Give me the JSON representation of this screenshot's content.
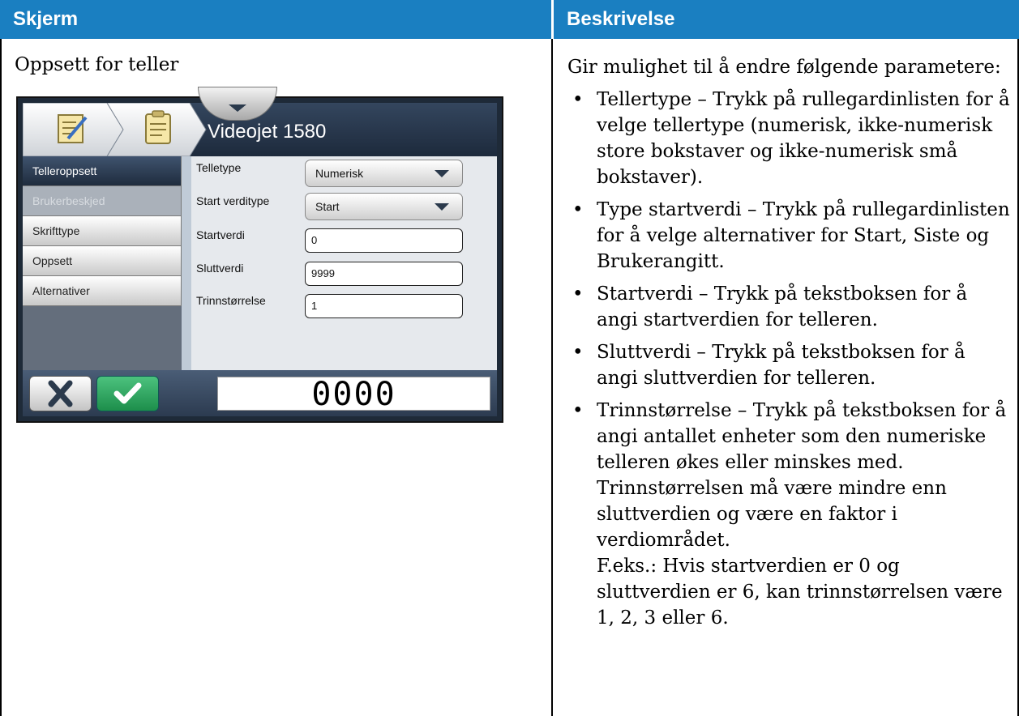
{
  "table": {
    "header_left": "Skjerm",
    "header_right": "Beskrivelse"
  },
  "screen_title": "Oppsett for teller",
  "device": {
    "title": "Videojet 1580",
    "sidebar": [
      {
        "label": "Telleroppsett",
        "state": "active"
      },
      {
        "label": "Brukerbeskjed",
        "state": "disabled"
      },
      {
        "label": "Skrifttype",
        "state": "normal"
      },
      {
        "label": "Oppsett",
        "state": "normal"
      },
      {
        "label": "Alternativer",
        "state": "normal"
      }
    ],
    "fields": {
      "telletype_label": "Telletype",
      "telletype_value": "Numerisk",
      "start_verditype_label": "Start verditype",
      "start_verditype_value": "Start",
      "startverdi_label": "Startverdi",
      "startverdi_value": "0",
      "sluttverdi_label": "Sluttverdi",
      "sluttverdi_value": "9999",
      "trinn_label": "Trinnstørrelse",
      "trinn_value": "1"
    },
    "preview_value": "0000",
    "colors": {
      "ok": "#1d8e4b",
      "header": "#1a7fc1"
    }
  },
  "description": {
    "intro": "Gir mulighet til å endre følgende parametere:",
    "bullets": [
      "Tellertype – Trykk på rullegardinlisten for å velge tellertype (numerisk, ikke-numerisk store bokstaver og ikke-numerisk små bokstaver).",
      "Type startverdi – Trykk på rullegardinlisten for å velge alternativer for Start, Siste og Brukerangitt.",
      "Startverdi – Trykk på tekstboksen for å angi startverdien for telleren.",
      "Sluttverdi – Trykk på tekstboksen for å angi sluttverdien for telleren.",
      "Trinnstørrelse – Trykk på tekstboksen for å angi antallet enheter som den numeriske telleren økes eller minskes med. Trinnstørrelsen må være mindre enn sluttverdien og være en faktor i verdiområdet."
    ],
    "example": "F.eks.: Hvis startverdien er 0 og sluttverdien er 6, kan trinnstørrelsen være 1, 2, 3 eller 6."
  }
}
